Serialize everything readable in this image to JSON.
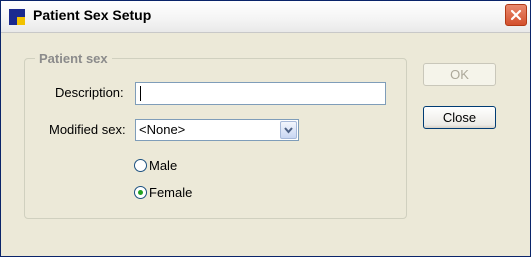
{
  "window": {
    "title": "Patient Sex Setup"
  },
  "group": {
    "legend": "Patient sex"
  },
  "description": {
    "label": "Description:",
    "value": ""
  },
  "modified_sex": {
    "label": "Modified sex:",
    "selected": "<None>"
  },
  "radios": [
    {
      "label": "Male",
      "checked": false
    },
    {
      "label": "Female",
      "checked": true
    }
  ],
  "buttons": {
    "ok": "OK",
    "close": "Close"
  },
  "colors": {
    "titlebar_close": "#d3502d",
    "radio_dot": "#21a121",
    "input_border": "#7f9db9"
  },
  "icons": {
    "app": "app-icon",
    "window_close": "close-icon",
    "dropdown": "chevron-down-icon"
  }
}
